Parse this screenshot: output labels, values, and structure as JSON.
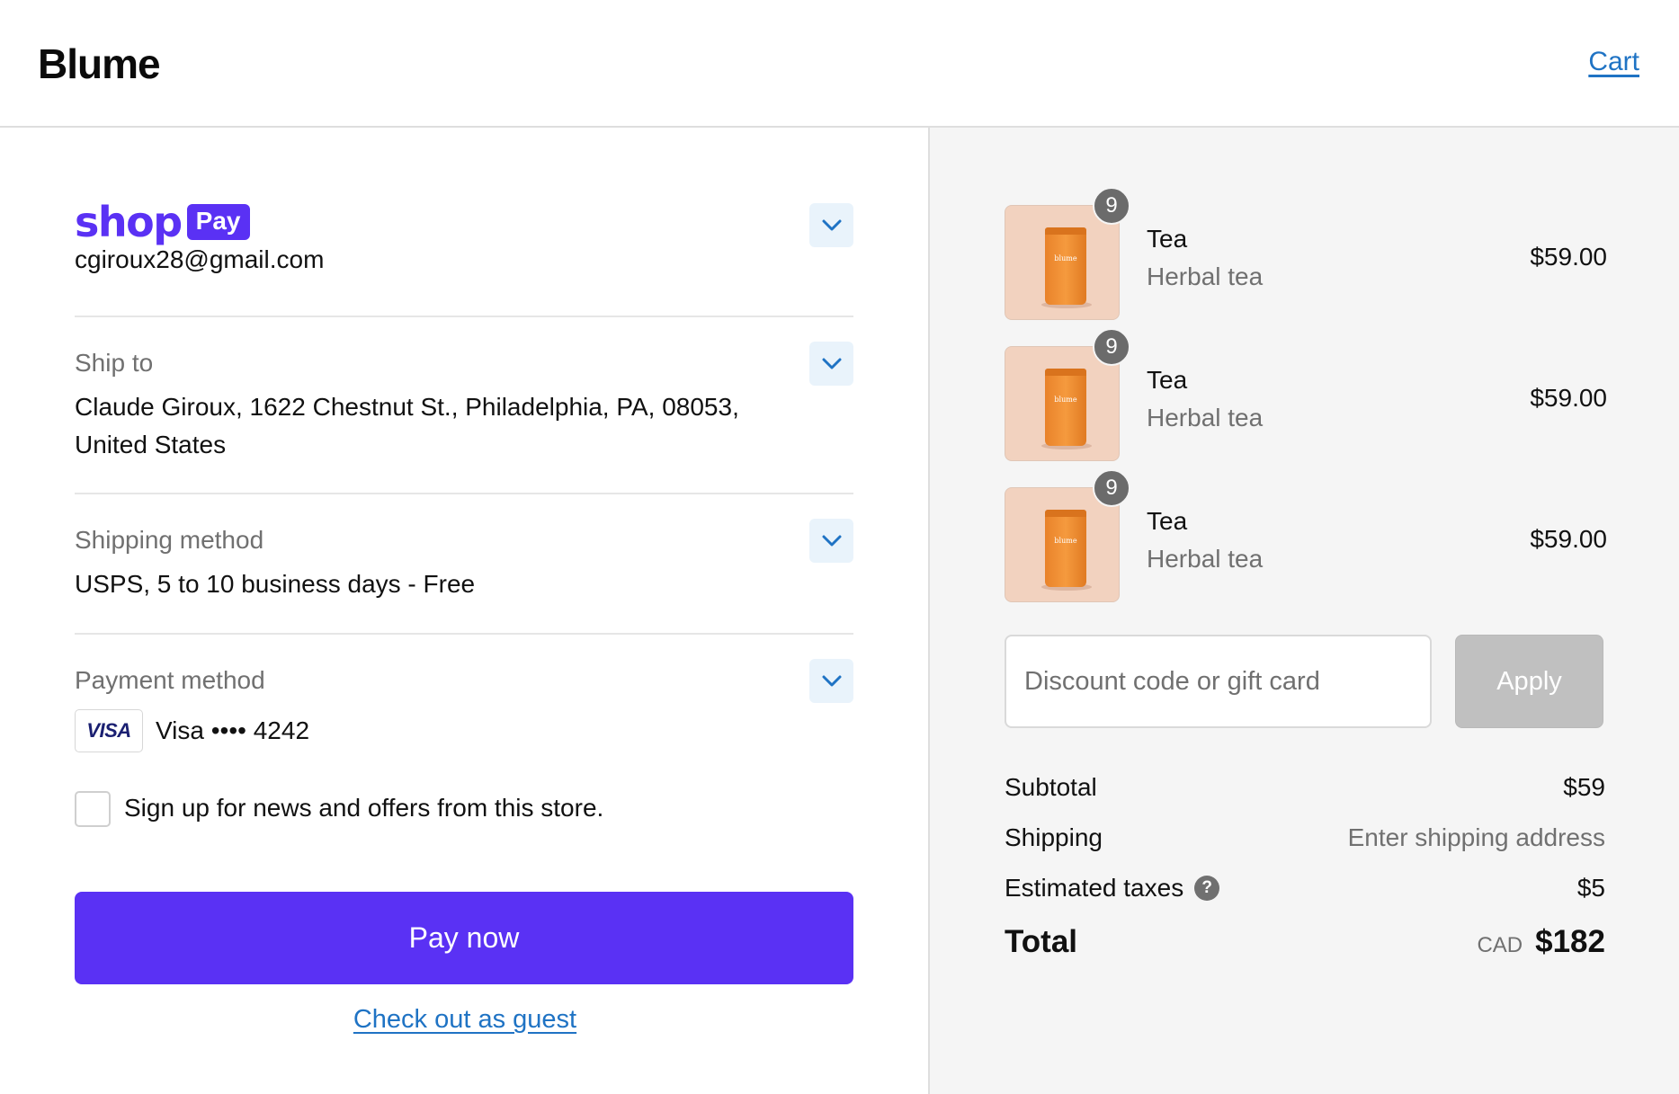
{
  "header": {
    "brand": "Blume",
    "cart_link": "Cart"
  },
  "checkout": {
    "shop_pay": {
      "logo_word": "shop",
      "logo_badge": "Pay",
      "email": "cgiroux28@gmail.com"
    },
    "ship_to": {
      "label": "Ship to",
      "address_line1": "Claude Giroux, 1622 Chestnut St., Philadelphia, PA, 08053,",
      "address_line2": "United States"
    },
    "shipping_method": {
      "label": "Shipping method",
      "value": "USPS, 5 to 10 business days - Free"
    },
    "payment_method": {
      "label": "Payment method",
      "card_brand": "VISA",
      "card_text": "Visa •••• 4242"
    },
    "newsletter": {
      "label": "Sign up for news and offers from this store.",
      "checked": false
    },
    "pay_now": "Pay now",
    "guest_link": "Check out as guest"
  },
  "cart": {
    "items": [
      {
        "name": "Tea",
        "variant": "Herbal tea",
        "price": "$59.00",
        "quantity": "9",
        "pouch_label": "blume"
      },
      {
        "name": "Tea",
        "variant": "Herbal tea",
        "price": "$59.00",
        "quantity": "9",
        "pouch_label": "blume"
      },
      {
        "name": "Tea",
        "variant": "Herbal tea",
        "price": "$59.00",
        "quantity": "9",
        "pouch_label": "blume"
      }
    ],
    "discount": {
      "placeholder": "Discount code or gift card",
      "apply_label": "Apply"
    },
    "summary": {
      "subtotal_label": "Subtotal",
      "subtotal_value": "$59",
      "shipping_label": "Shipping",
      "shipping_value": "Enter shipping address",
      "taxes_label": "Estimated taxes",
      "taxes_help": "?",
      "taxes_value": "$5",
      "total_label": "Total",
      "total_currency": "CAD",
      "total_value": "$182"
    }
  },
  "colors": {
    "shop_pay_purple": "#5a31f4",
    "link_blue": "#1f73c4",
    "chevron_bg": "#e9f3fb",
    "summary_bg": "#f5f5f5"
  },
  "icons": {
    "section_toggle": "chevron-down-icon",
    "tax_help": "question-circle-icon"
  }
}
